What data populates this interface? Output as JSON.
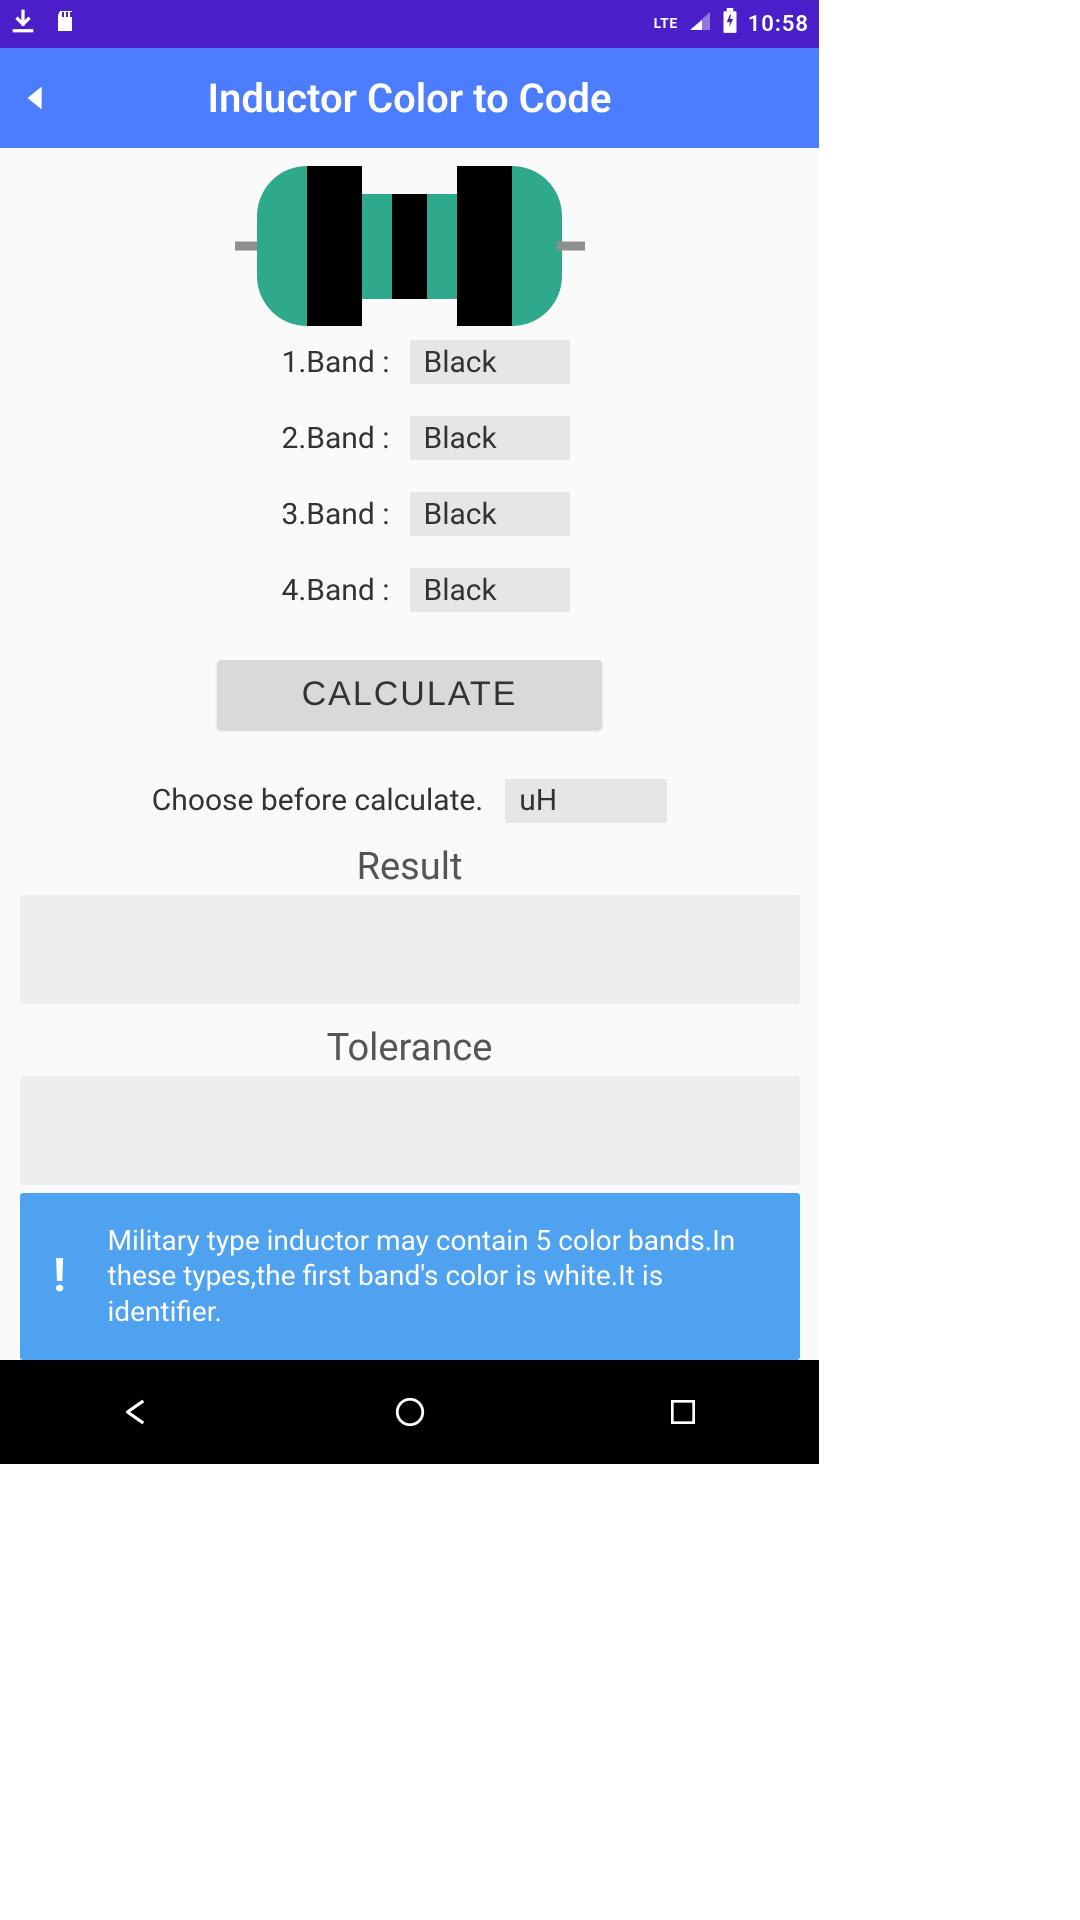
{
  "status": {
    "time": "10:58",
    "network": "LTE"
  },
  "header": {
    "title": "Inductor Color to Code"
  },
  "bands": [
    {
      "label": "1.Band :",
      "value": "Black"
    },
    {
      "label": "2.Band :",
      "value": "Black"
    },
    {
      "label": "3.Band :",
      "value": "Black"
    },
    {
      "label": "4.Band :",
      "value": "Black"
    }
  ],
  "calculate_label": "CALCULATE",
  "choose_label": "Choose before calculate.",
  "unit_value": "uH",
  "result_heading": "Result",
  "result_value": "",
  "tolerance_heading": "Tolerance",
  "tolerance_value": "",
  "info": {
    "icon": "!",
    "text": "Military type inductor may contain 5 color bands.In these types,the first band's color is white.It is identifier."
  }
}
